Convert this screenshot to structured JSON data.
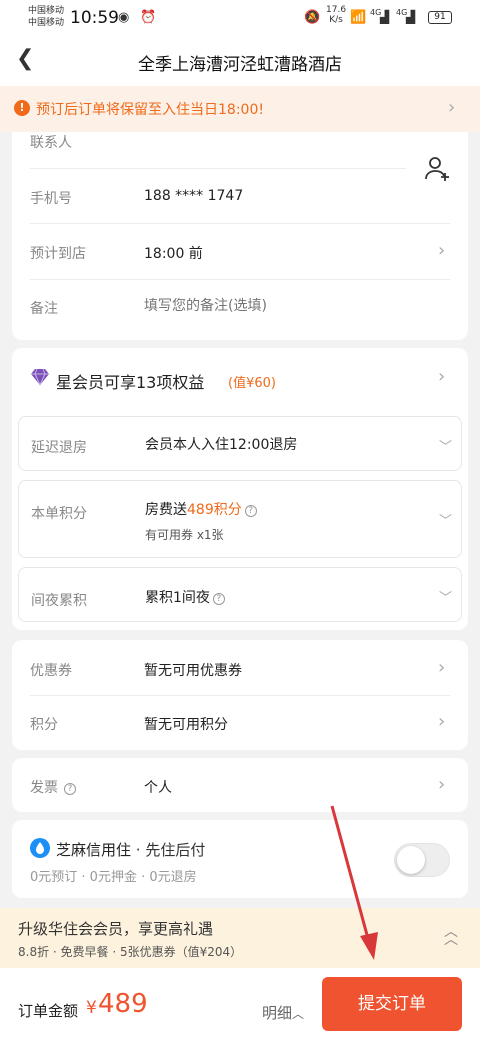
{
  "status_bar": {
    "carrier1": "中国移动",
    "carrier2": "中国移动",
    "time": "10:59",
    "net_speed": "17.6",
    "net_unit": "K/s",
    "net1": "4G",
    "net2": "4G",
    "battery": "91"
  },
  "header": {
    "title": "全季上海漕河泾虹漕路酒店"
  },
  "notice": {
    "text": "预订后订单将保留至入住当日18:00!"
  },
  "contact": {
    "contact_label": "联系人",
    "phone_label": "手机号",
    "phone_value": "188 **** 1747",
    "arrival_label": "预计到店",
    "arrival_value": "18:00 前",
    "remark_label": "备注",
    "remark_placeholder": "填写您的备注(选填)"
  },
  "membership": {
    "title": "星会员可享13项权益",
    "value_tag": "(值¥60)",
    "late_checkout_label": "延迟退房",
    "late_checkout_value": "会员本人入住12:00退房",
    "points_label": "本单积分",
    "points_prefix": "房费送",
    "points_amount": "489积分",
    "points_note": "有可用券 x1张",
    "nights_label": "间夜累积",
    "nights_value": "累积1间夜"
  },
  "discounts": {
    "coupon_label": "优惠券",
    "coupon_value": "暂无可用优惠券",
    "credit_label": "积分",
    "credit_value": "暂无可用积分"
  },
  "invoice": {
    "label": "发票",
    "value": "个人"
  },
  "zhima": {
    "title": "芝麻信用住",
    "subtitle": "· 先住后付",
    "details": "0元预订 · 0元押金 · 0元退房"
  },
  "upgrade": {
    "title": "升级华住会会员，享更高礼遇",
    "details": "8.8折 · 免费早餐 · 5张优惠券（值¥204）"
  },
  "bottom": {
    "amount_label": "订单金额",
    "currency": "¥",
    "amount": "489",
    "detail_label": "明细",
    "submit_label": "提交订单"
  },
  "colors": {
    "accent": "#f06a1a",
    "submit": "#f0532f",
    "arrow": "#d9383a"
  }
}
